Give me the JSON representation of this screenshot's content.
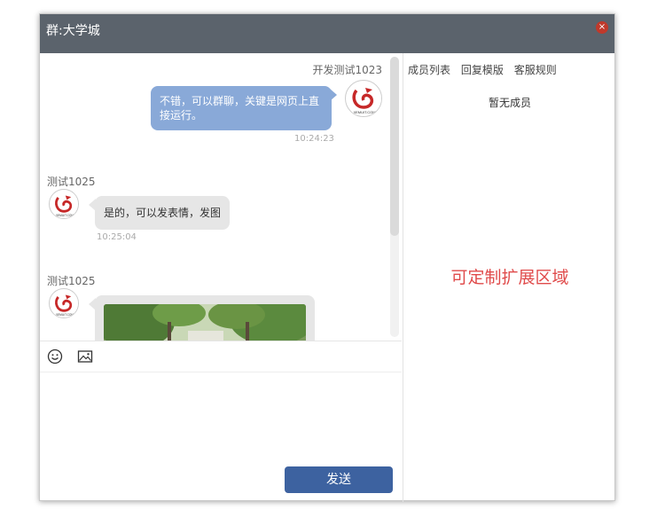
{
  "window": {
    "title": "群:大学城",
    "close_label": "×"
  },
  "messages": [
    {
      "sender": "开发测试1023",
      "text": "不错，可以群聊，关键是网页上直接运行。",
      "line1": "不错，可以群聊，关键是网页上直",
      "line2": "接运行。",
      "time": "10:24:23",
      "self": true
    },
    {
      "sender": "测试1025",
      "text": "是的，可以发表情，发图",
      "time": "10:25:04",
      "self": false
    },
    {
      "sender": "测试1025",
      "image": true,
      "self": false
    }
  ],
  "avatar_text": "XEMUIT.COM",
  "composer": {
    "send_label": "发送",
    "emoji_icon": "emoji-icon",
    "image_icon": "image-icon"
  },
  "sidebar": {
    "tabs": [
      "成员列表",
      "回复模版",
      "客服规则"
    ],
    "empty_text": "暂无成员",
    "extension_text": "可定制扩展区域"
  },
  "colors": {
    "titlebar": "#5b636c",
    "self_bubble": "#89a9d8",
    "other_bubble": "#e6e6e6",
    "send": "#3d62a0",
    "extension": "#e04b4b"
  }
}
